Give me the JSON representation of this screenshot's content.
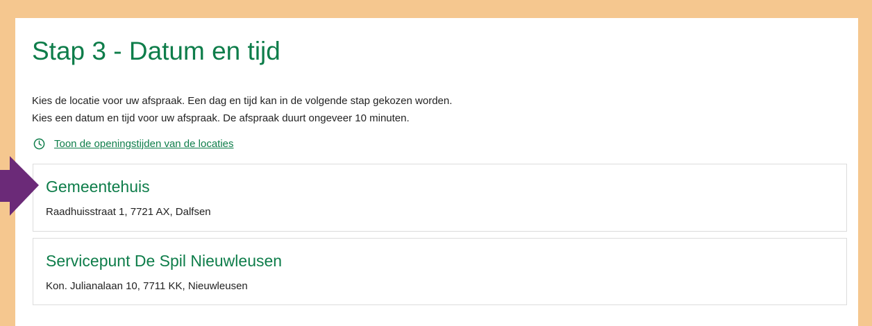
{
  "page": {
    "title": "Stap 3 - Datum en tijd",
    "intro_lines": [
      "Kies de locatie voor uw afspraak. Een dag en tijd kan in de volgende stap gekozen worden.",
      "Kies een datum en tijd voor uw afspraak. De afspraak duurt ongeveer 10 minuten."
    ],
    "opening_hours_link": "Toon de openingstijden van de locaties"
  },
  "locations": [
    {
      "name": "Gemeentehuis",
      "address": "Raadhuisstraat 1, 7721 AX, Dalfsen"
    },
    {
      "name": "Servicepunt De Spil Nieuwleusen",
      "address": "Kon. Julianalaan 10, 7711 KK, Nieuwleusen"
    }
  ],
  "colors": {
    "accent_green": "#0e7d4a",
    "frame_orange": "#f5c78f",
    "arrow_purple": "#6b2a78",
    "card_border": "#dcdcdc"
  },
  "icons": {
    "opening_hours": "clock-icon",
    "pointer": "arrow-right-icon"
  }
}
